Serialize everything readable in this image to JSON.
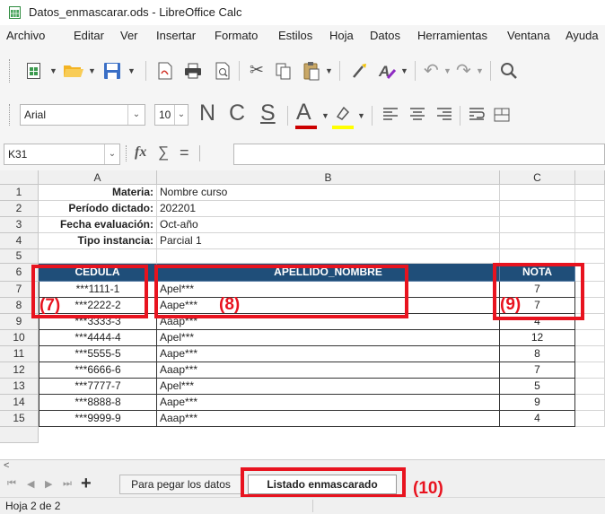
{
  "window": {
    "title": "Datos_enmascarar.ods - LibreOffice Calc"
  },
  "menu": [
    "Archivo",
    "Editar",
    "Ver",
    "Insertar",
    "Formato",
    "Estilos",
    "Hoja",
    "Datos",
    "Herramientas",
    "Ventana",
    "Ayuda"
  ],
  "format_toolbar": {
    "font_name": "Arial",
    "font_size": "10",
    "bold": "N",
    "italic": "C",
    "underline": "S",
    "font_color_glyph": "A"
  },
  "formula_bar": {
    "name_box": "K31",
    "fx": "fx",
    "sum": "∑",
    "equals": "=",
    "content": ""
  },
  "columns": [
    "A",
    "B",
    "C"
  ],
  "rows": [
    {
      "n": "1",
      "a": "Materia:",
      "b": "Nombre curso",
      "c": ""
    },
    {
      "n": "2",
      "a": "Período dictado:",
      "b": "202201",
      "c": ""
    },
    {
      "n": "3",
      "a": "Fecha evaluación:",
      "b": "Oct-año",
      "c": ""
    },
    {
      "n": "4",
      "a": "Tipo instancia:",
      "b": "Parcial 1",
      "c": ""
    },
    {
      "n": "5",
      "a": "",
      "b": "",
      "c": ""
    },
    {
      "n": "6",
      "a": "CEDULA",
      "b": "APELLIDO_NOMBRE",
      "c": "NOTA"
    },
    {
      "n": "7",
      "a": "***1111-1",
      "b": "Apel***",
      "c": "7"
    },
    {
      "n": "8",
      "a": "***2222-2",
      "b": "Aape***",
      "c": "7"
    },
    {
      "n": "9",
      "a": "***3333-3",
      "b": "Aaap***",
      "c": "4"
    },
    {
      "n": "10",
      "a": "***4444-4",
      "b": "Apel***",
      "c": "12"
    },
    {
      "n": "11",
      "a": "***5555-5",
      "b": "Aape***",
      "c": "8"
    },
    {
      "n": "12",
      "a": "***6666-6",
      "b": "Aaap***",
      "c": "7"
    },
    {
      "n": "13",
      "a": "***7777-7",
      "b": "Apel***",
      "c": "5"
    },
    {
      "n": "14",
      "a": "***8888-8",
      "b": "Aape***",
      "c": "9"
    },
    {
      "n": "15",
      "a": "***9999-9",
      "b": "Aaap***",
      "c": "4"
    }
  ],
  "annotations": [
    "(7)",
    "(8)",
    "(9)",
    "(10)"
  ],
  "sheet_tabs": [
    "Para pegar los datos",
    "Listado enmascarado"
  ],
  "status": {
    "sheet": "Hoja 2 de 2"
  },
  "colors": {
    "header_fill": "#1f4e79",
    "annotation_red": "#e8131f",
    "font_color": "#cc0000",
    "highlight": "#ffff00"
  }
}
